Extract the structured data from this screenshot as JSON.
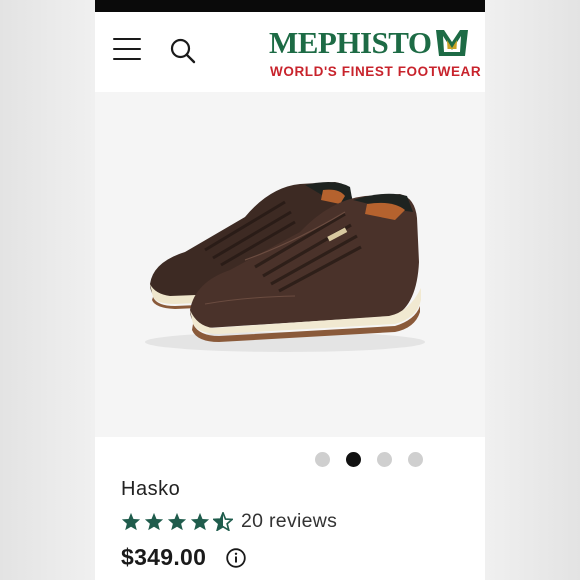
{
  "header": {
    "brand_name": "MEPHISTO",
    "brand_tagline": "WORLD'S FINEST FOOTWEAR",
    "menu_icon": "hamburger-menu-icon",
    "search_icon": "search-icon"
  },
  "gallery": {
    "total_slides": 4,
    "active_slide": 2
  },
  "product": {
    "name": "Hasko",
    "rating": 4.5,
    "reviews_label": "20 reviews",
    "price": "$349.00"
  },
  "colors": {
    "brand_green": "#1d6b45",
    "brand_red": "#c8232c",
    "star_color": "#1f5c4c",
    "active_dot": "#111111",
    "inactive_dot": "#cfcfcf"
  }
}
